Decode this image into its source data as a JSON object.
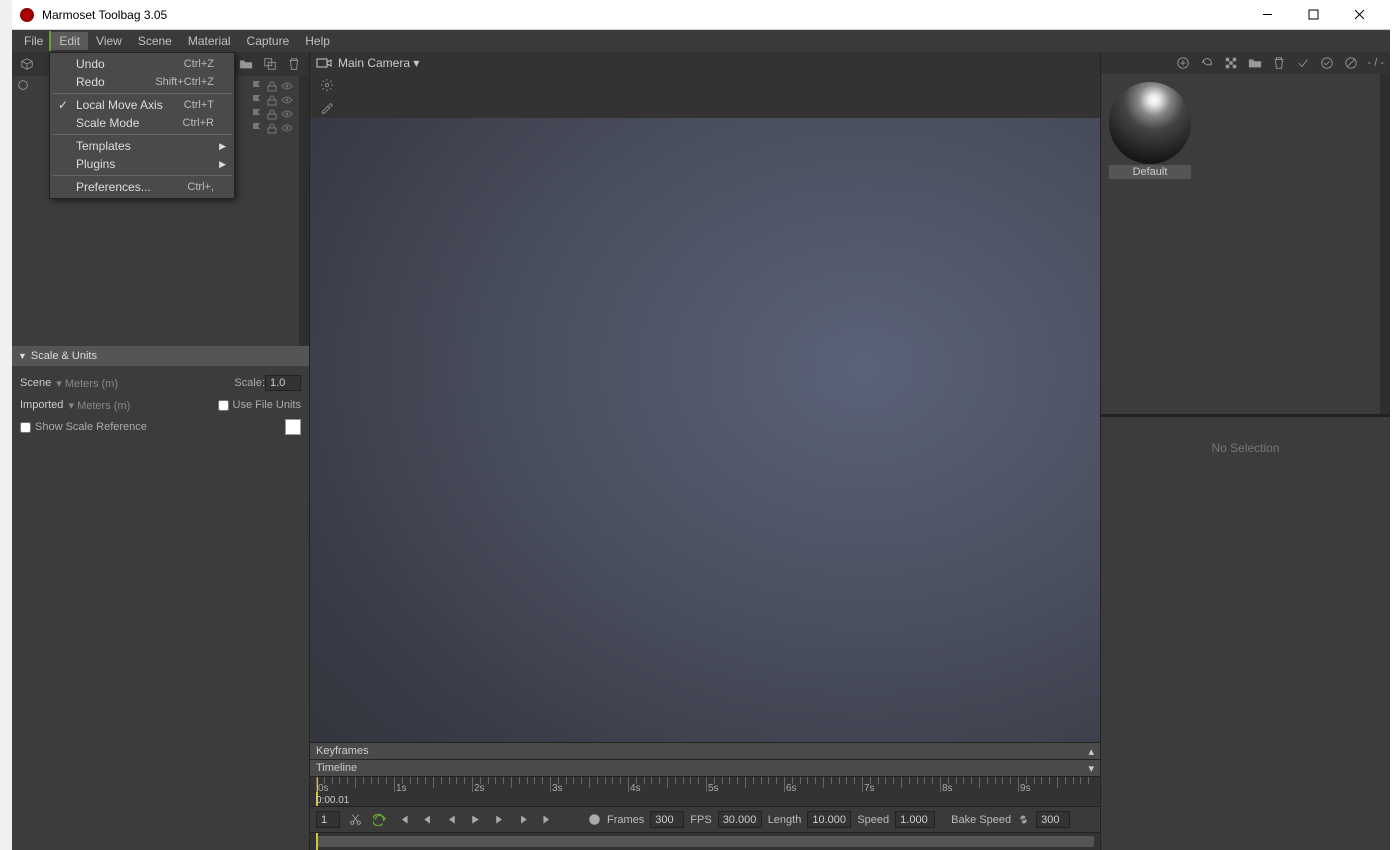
{
  "window": {
    "title": "Marmoset Toolbag 3.05"
  },
  "menubar": {
    "items": [
      "File",
      "Edit",
      "View",
      "Scene",
      "Material",
      "Capture",
      "Help"
    ],
    "active": 1
  },
  "edit_menu": {
    "undo": {
      "label": "Undo",
      "shortcut": "Ctrl+Z"
    },
    "redo": {
      "label": "Redo",
      "shortcut": "Shift+Ctrl+Z"
    },
    "local_move": {
      "label": "Local Move Axis",
      "shortcut": "Ctrl+T",
      "checked": true
    },
    "scale_mode": {
      "label": "Scale Mode",
      "shortcut": "Ctrl+R"
    },
    "templates": {
      "label": "Templates"
    },
    "plugins": {
      "label": "Plugins"
    },
    "prefs": {
      "label": "Preferences...",
      "shortcut": "Ctrl+,"
    }
  },
  "viewport": {
    "camera_label": "Main Camera"
  },
  "scale_units": {
    "title": "Scale & Units",
    "scene_label": "Scene",
    "scene_units": "Meters (m)",
    "scale_label": "Scale:",
    "scale_value": "1.0",
    "imported_label": "Imported",
    "imported_units": "Meters (m)",
    "use_file_units": "Use File Units",
    "show_ref": "Show Scale Reference"
  },
  "materials": {
    "default_name": "Default"
  },
  "inspector": {
    "no_selection": "No Selection"
  },
  "timeline": {
    "keyframes_label": "Keyframes",
    "timeline_label": "Timeline",
    "ticks": [
      "0s",
      "1s",
      "2s",
      "3s",
      "4s",
      "5s",
      "6s",
      "7s",
      "8s",
      "9s"
    ],
    "current_time": "0:00.01",
    "frame_number": "1",
    "frames_label": "Frames",
    "frames": "300",
    "fps_label": "FPS",
    "fps": "30.000",
    "length_label": "Length",
    "length": "10.000",
    "speed_label": "Speed",
    "speed": "1.000",
    "bake_speed_label": "Bake Speed",
    "bake_frames": "300"
  },
  "toolbar_right_text": "- / -"
}
